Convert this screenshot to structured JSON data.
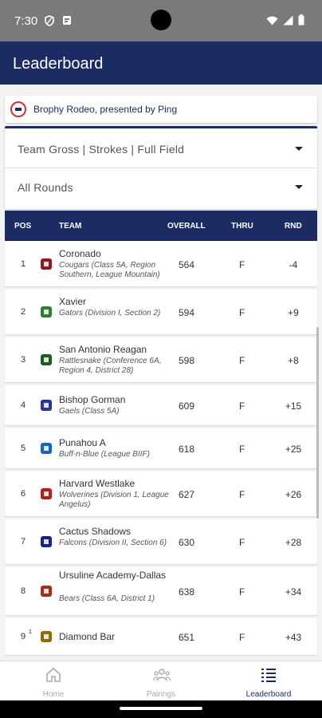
{
  "status_bar": {
    "time": "7:30"
  },
  "app_bar": {
    "title": "Leaderboard"
  },
  "event": {
    "name": "Brophy Rodeo, presented by Ping"
  },
  "filters": {
    "scoring": "Team Gross | Strokes | Full Field",
    "rounds": "All Rounds"
  },
  "table": {
    "headers": {
      "pos": "POS",
      "team": "TEAM",
      "overall": "OVERALL",
      "thru": "THRU",
      "rnd": "RND"
    },
    "rows": [
      {
        "pos": "1",
        "team": "Coronado",
        "sub": "Cougars (Class 5A, Region Southern, League Mountain)",
        "overall": "564",
        "thru": "F",
        "rnd": "-4",
        "logo_color": "#8b1a1a"
      },
      {
        "pos": "2",
        "team": "Xavier",
        "sub": "Gators (Division I, Section 2)",
        "overall": "594",
        "thru": "F",
        "rnd": "+9",
        "logo_color": "#2e7d32"
      },
      {
        "pos": "3",
        "team": "San Antonio Reagan",
        "sub": "Rattlesnake (Conference 6A, Region 4, District 28)",
        "overall": "598",
        "thru": "F",
        "rnd": "+8",
        "logo_color": "#1b5e20"
      },
      {
        "pos": "4",
        "team": "Bishop Gorman",
        "sub": "Gaels (Class 5A)",
        "overall": "609",
        "thru": "F",
        "rnd": "+15",
        "logo_color": "#283593"
      },
      {
        "pos": "5",
        "team": "Punahou A",
        "sub": "Buff-n-Blue (League BIIF)",
        "overall": "618",
        "thru": "F",
        "rnd": "+25",
        "logo_color": "#1565c0"
      },
      {
        "pos": "6",
        "team": "Harvard Westlake",
        "sub": "Wolverines (Division 1, League Angelus)",
        "overall": "627",
        "thru": "F",
        "rnd": "+26",
        "logo_color": "#b71c1c"
      },
      {
        "pos": "7",
        "team": "Cactus Shadows",
        "sub": "Falcons (Division II, Section 6)",
        "overall": "630",
        "thru": "F",
        "rnd": "+28",
        "logo_color": "#1a237e"
      },
      {
        "pos": "8",
        "team": "Ursuline Academy-Dallas",
        "sub": "Bears (Class 6A, District 1)",
        "overall": "638",
        "thru": "F",
        "rnd": "+34",
        "logo_color": "#a0301a"
      },
      {
        "pos": "9",
        "pos_sup": "1",
        "team": "Diamond Bar",
        "sub": "",
        "overall": "651",
        "thru": "F",
        "rnd": "+43",
        "logo_color": "#8d6e00"
      }
    ]
  },
  "bottom_nav": {
    "home": "Home",
    "pairings": "Pairings",
    "leaderboard": "Leaderboard"
  },
  "colors": {
    "primary": "#1d2b63",
    "active_nav": "#1d2b63",
    "inactive_nav": "#aaaaaa"
  }
}
